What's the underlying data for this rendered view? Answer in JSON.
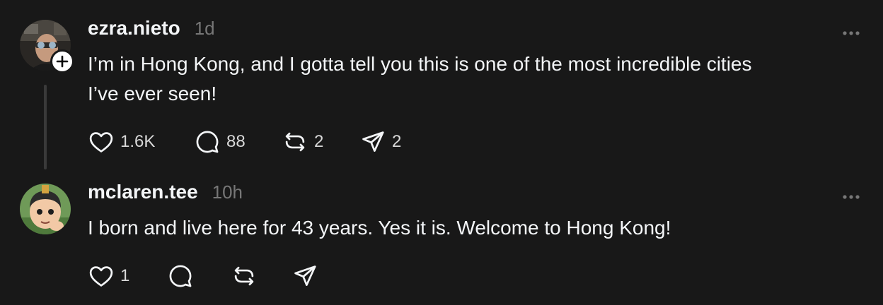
{
  "comments": [
    {
      "username": "ezra.nieto",
      "time": "1d",
      "text_line1": "I’m in Hong Kong, and I gotta tell you this is one of the most incredible cities",
      "text_line2": "I’ve ever seen!",
      "likes": "1.6K",
      "replies": "88",
      "reposts": "2",
      "shares": "2",
      "has_follow_badge": true
    },
    {
      "username": "mclaren.tee",
      "time": "10h",
      "text_line1": "I born and live here for 43 years. Yes it is. Welcome to Hong Kong!",
      "likes": "1",
      "replies": "",
      "reposts": "",
      "shares": ""
    }
  ],
  "colors": {
    "background": "#181818",
    "text": "#f3f5f7",
    "muted": "#777777",
    "thread_line": "#3a3a3a"
  },
  "icons": [
    "heart-icon",
    "comment-icon",
    "repost-icon",
    "share-icon",
    "more-icon",
    "plus-icon"
  ]
}
